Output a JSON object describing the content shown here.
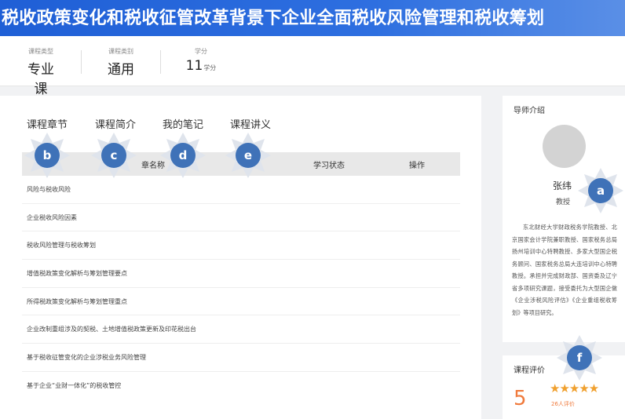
{
  "course": {
    "title": "税收政策变化和税收征管改革背景下企业全面税收风险管理和税收筹划"
  },
  "meta": [
    {
      "label": "课程类型",
      "value": "专业课",
      "unit": ""
    },
    {
      "label": "课程类别",
      "value": "通用",
      "unit": ""
    },
    {
      "label": "学分",
      "value": "11",
      "unit": "学分"
    }
  ],
  "tabs": [
    "课程章节",
    "课程简介",
    "我的笔记",
    "课程讲义"
  ],
  "table": {
    "headers": [
      "章名称",
      "学习状态",
      "操作"
    ],
    "rows": [
      "风险与税收风险",
      "企业税收风险因素",
      "税收风险管理与税收筹划",
      "增值税政策变化解析与筹划管理要点",
      "所得税政策变化解析与筹划管理重点",
      "企业改制重组涉及的契税、土地增值税政策更新及印花税出台",
      "基于税收征管变化的企业涉税业务风险管理",
      "基于企业“业财一体化”的税收管控"
    ]
  },
  "teacher": {
    "section_title": "导师介绍",
    "name": "张纬",
    "title": "教授",
    "bio": "东北财经大学财政税务学院教授、北京国家会计学院兼职教授、国家税务总局扬州培训中心特聘教授、多家大型国企税务顾问、国家税务总局大连培训中心特聘教授。承担并完成财政部、国资委及辽宁省多项研究课题，接受委托为大型国企做《企业涉税风险评估》《企业重组税收筹划》等项目研究。"
  },
  "rating": {
    "section_title": "课程评价",
    "score": "5",
    "stars": 5,
    "review_count": "26人评价"
  },
  "annotations": [
    "a",
    "b",
    "c",
    "d",
    "e",
    "f"
  ],
  "colors": {
    "banner": "#2563d8",
    "badge": "#3f72b8",
    "accent": "#f07a3c",
    "star": "#f0a02e"
  }
}
